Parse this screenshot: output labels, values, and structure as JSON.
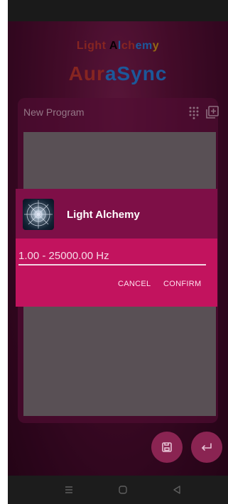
{
  "branding": {
    "top_line": "Light Alchemy",
    "top_line_colors": [
      "#c0392b",
      "#c0392b",
      "#c0392b",
      "#c0392b",
      "#c0392b",
      "#000000",
      "#1e88e5",
      "#c0392b",
      "#c0392b",
      "#1e88e5",
      "#1e88e5",
      "#d4a017",
      "#27ae60"
    ],
    "app_name": "AuraSync",
    "app_name_colors": [
      "#c0392b",
      "#c0392b",
      "#c0392b",
      "#1e88e5",
      "#1e88e5",
      "#1e88e5",
      "#1e88e5",
      "#1e88e5"
    ]
  },
  "program_card": {
    "title": "New Program",
    "icons": [
      "grid-icon",
      "add-icon"
    ]
  },
  "dialog": {
    "title": "Light Alchemy",
    "input_placeholder": "1.00 - 25000.00 Hz",
    "cancel_label": "CANCEL",
    "confirm_label": "CONFIRM"
  },
  "bottom_actions": {
    "icons": [
      "save-icon",
      "return-icon"
    ]
  },
  "system_nav": {
    "icons": [
      "menu-icon",
      "home-icon",
      "back-icon"
    ]
  },
  "colors": {
    "dialog_header": "#7e0f47",
    "dialog_body": "#c2135e",
    "canvas": "#7b7b7b"
  }
}
